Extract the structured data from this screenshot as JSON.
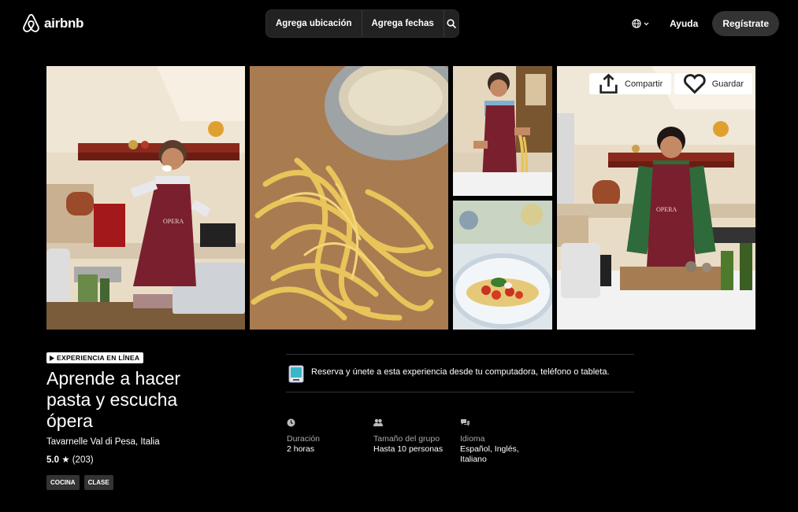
{
  "header": {
    "logo_text": "airbnb",
    "search": {
      "location_label": "Agrega ubicación",
      "dates_label": "Agrega fechas"
    },
    "help_label": "Ayuda",
    "signup_label": "Regístrate"
  },
  "gallery": {
    "share_label": "Compartir",
    "save_label": "Guardar"
  },
  "experience": {
    "badge": "EXPERIENCIA EN LÍNEA",
    "title": "Aprende a hacer pasta y escucha ópera",
    "location": "Tavarnelle Val di Pesa, Italia",
    "rating": "5.0",
    "reviews": "(203)",
    "tags": [
      "COCINA",
      "CLASE"
    ]
  },
  "online_note": "Reserva y únete a esta experiencia desde tu computadora, teléfono o tableta.",
  "facts": [
    {
      "icon": "clock-icon",
      "label": "Duración",
      "value": "2 horas"
    },
    {
      "icon": "group-icon",
      "label": "Tamaño del grupo",
      "value": "Hasta 10 personas"
    },
    {
      "icon": "speech-bubbles-icon",
      "label": "Idioma",
      "value": "Español, Inglés, Italiano"
    }
  ],
  "colors": {
    "background": "#000000",
    "button_dark": "#333333",
    "apron": "#7a1f2e"
  }
}
